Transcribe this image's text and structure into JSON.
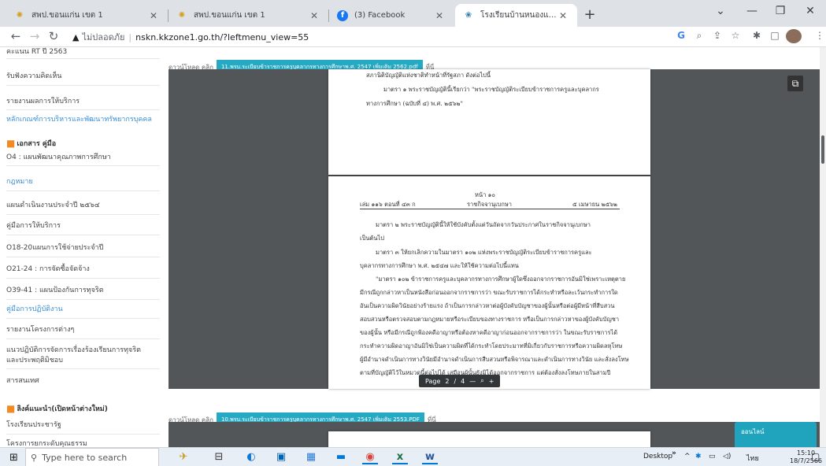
{
  "browser": {
    "tabs": [
      {
        "title": "สพป.ขอนแก่น เขต 1",
        "favicon": "ministry-emblem-icon"
      },
      {
        "title": "สพป.ขอนแก่น เขต 1",
        "favicon": "ministry-emblem-icon"
      },
      {
        "title": "(3) Facebook",
        "favicon": "facebook-icon"
      },
      {
        "title": "โรงเรียนบ้านหนองแสงโคกน้อย สังกัด",
        "favicon": "school-emblem-icon"
      }
    ],
    "address": {
      "warning": "ไม่ปลอดภัย",
      "url": "nskn.kkzone1.go.th/?leftmenu_view=55"
    },
    "toolbar_icons": [
      "google-icon",
      "zoom-icon",
      "share-icon",
      "bookmark-star-icon",
      "extensions-icon",
      "sidepanel-icon",
      "profile-avatar",
      "menu-kebab-icon"
    ]
  },
  "sidebar": {
    "items_top": [
      {
        "label": "คะแนน RT ปี 2563",
        "style": "plain"
      },
      {
        "label": "รับฟังความคิดเห็น",
        "style": "plain"
      },
      {
        "label": "รายงานผลการให้บริการ",
        "style": "plain"
      },
      {
        "label": "หลักเกณฑ์การบริหารและพัฒนาทรัพยากรบุคคล",
        "style": "link"
      }
    ],
    "section1": "เอกสาร คู่มือ",
    "items_section1": [
      {
        "label": "O4 : แผนพัฒนาคุณภาพการศึกษา",
        "style": "plain"
      },
      {
        "label": "กฎหมาย",
        "style": "link"
      },
      {
        "label": "แผนดำเนินงานประจำปี ๒๕๖๔",
        "style": "plain"
      },
      {
        "label": "คู่มือการให้บริการ",
        "style": "plain"
      },
      {
        "label": "O18-20แผนการใช้จ่ายประจำปี",
        "style": "plain"
      },
      {
        "label": "O21-24 : การจัดซื้อจัดจ้าง",
        "style": "plain"
      },
      {
        "label": "O39-41 : แผนป้องกันการทุจริต",
        "style": "plain"
      },
      {
        "label": "คู่มือการปฏิบัติงาน",
        "style": "link"
      },
      {
        "label": "รายงานโครงการต่างๆ",
        "style": "plain"
      },
      {
        "label": "แนวปฏิบัติการจัดการเรื่องร้องเรียนการทุจริต",
        "style": "plain"
      },
      {
        "label": "และประพฤติมิชอบ",
        "style": "plain"
      },
      {
        "label": "สารสนเทศ",
        "style": "plain"
      }
    ],
    "section2": "ลิงค์แนะนำ(เปิดหน้าต่างใหม่)",
    "items_section2": [
      {
        "label": "โรงเรียนประชารัฐ",
        "style": "plain"
      },
      {
        "label": "โครงการยกระดับคุณธรรม",
        "style": "plain"
      }
    ]
  },
  "viewer": {
    "download_prefix": "ดาวน์โหลด คลิก",
    "download_suffix": "ที่นี่",
    "files": [
      "11.พรบ.ระเบียบข้าราชการครูบุคลากรทางการศึกษาพ.ศ. 2547 เพิ่มเติม 2562.pdf",
      "10.พรบ.ระเบียบข้าราชการครูบุคลากรทางการศึกษาพ.ศ. 2547 เพิ่มเติม 2553.PDF"
    ],
    "page1_lines": [
      "สภานิติบัญญัติแห่งชาติทำหน้าที่รัฐสภา ดังต่อไปนี้",
      "มาตรา ๑ พระราชบัญญัตินี้เรียกว่า \"พระราชบัญญัติระเบียบข้าราชการครูและบุคลากร",
      "ทางการศึกษา (ฉบับที่ ๔) พ.ศ. ๒๕๖๒\""
    ],
    "page2": {
      "page_no": "หน้า ๑๐",
      "header_left": "เล่ม ๑๑๖ ตอนที่ ๔๓ ก",
      "header_center": "ราชกิจจานุเบกษา",
      "header_right": "๕ เมษายน ๒๕๖๒",
      "lines": [
        "มาตรา ๒ พระราชบัญญัตินี้ให้ใช้บังคับตั้งแต่วันถัดจากวันประกาศในราชกิจจานุเบกษา",
        "เป็นต้นไป",
        "มาตรา ๓ ให้ยกเลิกความในมาตรา ๑๐๒ แห่งพระราชบัญญัติระเบียบข้าราชการครูและ",
        "บุคลากรทางการศึกษา พ.ศ. ๒๕๔๗ และให้ใช้ความต่อไปนี้แทน",
        "\"มาตรา ๑๐๒ ข้าราชการครูและบุคลากรทางการศึกษาผู้ใดซึ่งออกจากราชการอันมิใช่เพราะเหตุตาย",
        "มีกรณีถูกกล่าวหาเป็นหนังสือก่อนออกจากราชการว่า ขณะรับราชการได้กระทำหรือละเว้นกระทำการใด",
        "อันเป็นความผิดวินัยอย่างร้ายแรง ถ้าเป็นการกล่าวหาต่อผู้บังคับบัญชาของผู้นั้นหรือต่อผู้มีหน้าที่สืบสวน",
        "สอบสวนหรือตรวจสอบตามกฎหมายหรือระเบียบของทางราชการ หรือเป็นการกล่าวหาของผู้บังคับบัญชา",
        "ของผู้นั้น หรือมีกรณีถูกฟ้องคดีอาญาหรือต้องหาคดีอาญาก่อนออกจากราชการว่า ในขณะรับราชการได้",
        "กระทำความผิดอาญาอันมิใช่เป็นความผิดที่ได้กระทำโดยประมาทที่มิเกี่ยวกับราชการหรือความผิดลหุโทษ",
        "ผู้มีอำนาจดำเนินการทางวินัยมีอำนาจดำเนินการสืบสวนหรือพิจารณาและดำเนินการทางวินัย และสั่งลงโทษ",
        "ตามที่บัญญัติไว้ในหมวดนี้ต่อไปได้ เสมือนผู้นั้นยังมิได้ออกจากราชการ แต่ต้องสั่งลงโทษภายในสามปี"
      ]
    },
    "pager": {
      "label": "Page",
      "current": "2",
      "divider": "/",
      "total": "4",
      "zoom_out": "—",
      "zoom_in": "+"
    },
    "online_button": "ออนไลน์"
  },
  "taskbar": {
    "search_placeholder": "Type here to search",
    "desktop": "Desktop",
    "chevron": "»",
    "lang": "ไทย",
    "time": "15:10",
    "date": "18/7/2566"
  }
}
